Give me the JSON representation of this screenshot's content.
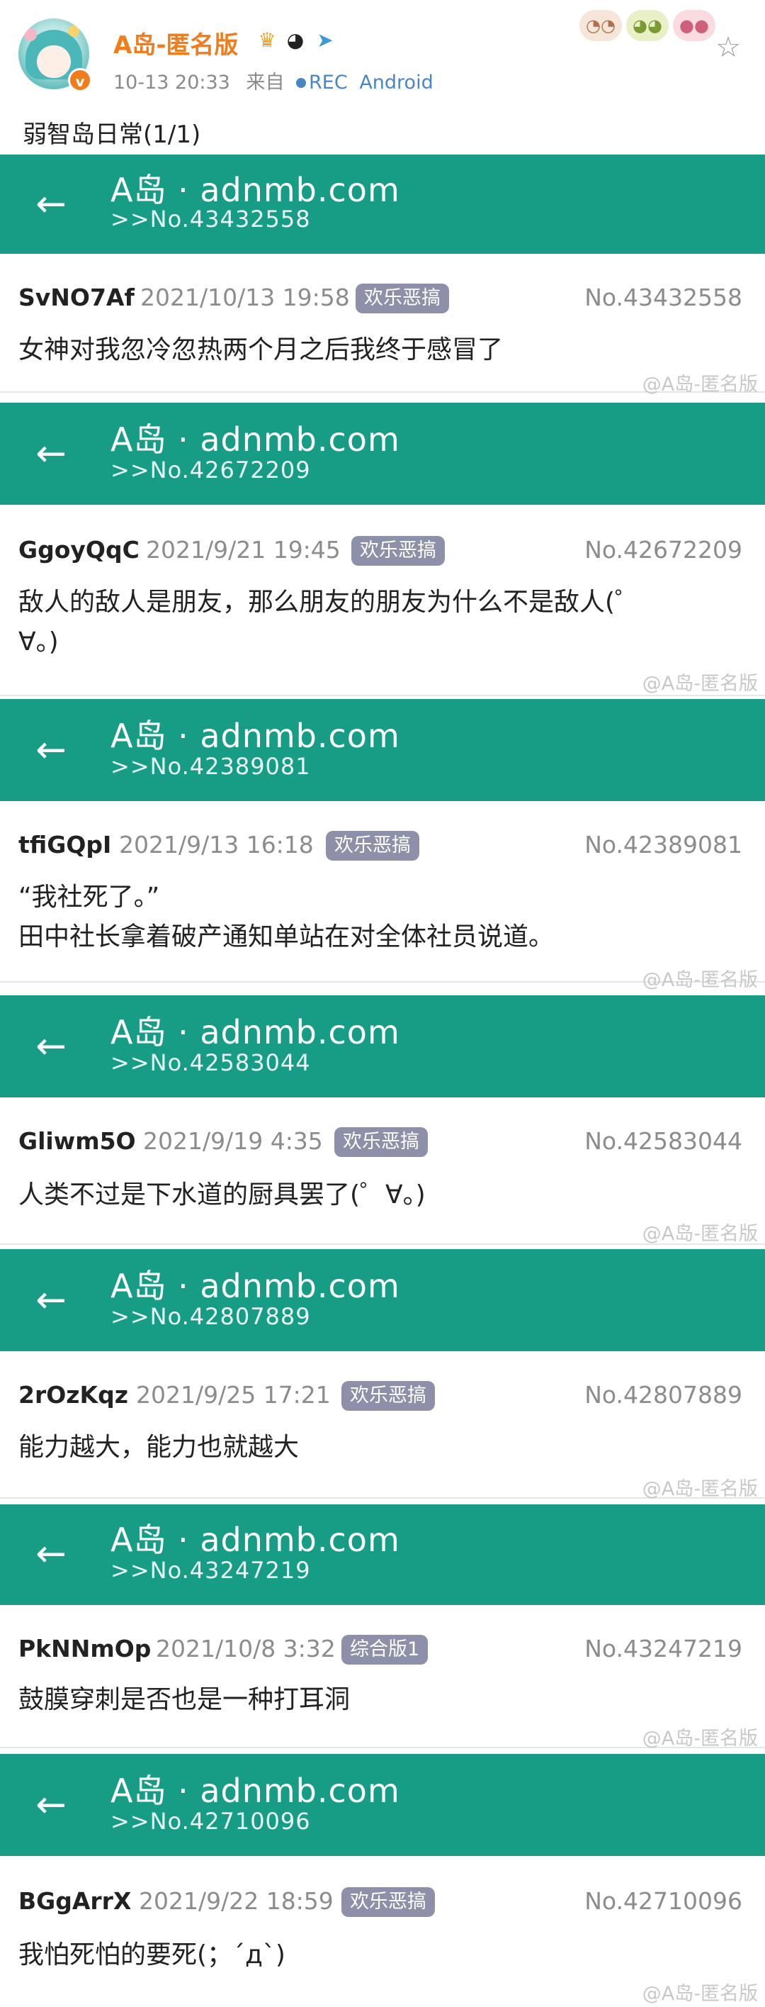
{
  "post": {
    "author": "A岛-匿名版",
    "time": "10-13 20:33",
    "from_label": "来自",
    "source": "REC",
    "client": "Android",
    "text": "弱智岛日常(1/1)",
    "author_icons": [
      "crown-icon",
      "panda-icon",
      "paper-plane-icon"
    ],
    "reaction_emojis": [
      "mouse-emoji",
      "frog-emoji",
      "pig-emoji"
    ]
  },
  "site_title": "A岛 · adnmb.com",
  "watermark_text": "@A岛-匿名版",
  "cards": [
    {
      "ref": ">>No.43432558",
      "uid": "SvNO7Af",
      "date": "2021/10/13 19:58",
      "tag": "欢乐恶搞",
      "no": "No.43432558",
      "content": "女神对我忽冷忽热两个月之后我终于感冒了"
    },
    {
      "ref": ">>No.42672209",
      "uid": "GgoyQqC",
      "date": "2021/9/21 19:45",
      "tag": "欢乐恶搞",
      "no": "No.42672209",
      "content": "敌人的敌人是朋友，那么朋友的朋友为什么不是敌人(゜\n∀。)"
    },
    {
      "ref": ">>No.42389081",
      "uid": "tfiGQpI",
      "date": "2021/9/13 16:18",
      "tag": "欢乐恶搞",
      "no": "No.42389081",
      "content": "“我社死了。”\n田中社长拿着破产通知单站在对全体社员说道。"
    },
    {
      "ref": ">>No.42583044",
      "uid": "Gliwm5O",
      "date": "2021/9/19 4:35",
      "tag": "欢乐恶搞",
      "no": "No.42583044",
      "content": "人类不过是下水道的厨具罢了(゜∀。)"
    },
    {
      "ref": ">>No.42807889",
      "uid": "2rOzKqz",
      "date": "2021/9/25 17:21",
      "tag": "欢乐恶搞",
      "no": "No.42807889",
      "content": "能力越大，能力也就越大"
    },
    {
      "ref": ">>No.43247219",
      "uid": "PkNNmOp",
      "date": "2021/10/8 3:32",
      "tag": "综合版1",
      "no": "No.43247219",
      "content": "鼓膜穿刺是否也是一种打耳洞"
    },
    {
      "ref": ">>No.42710096",
      "uid": "BGgArrX",
      "date": "2021/9/22 18:59",
      "tag": "欢乐恶搞",
      "no": "No.42710096",
      "content": "我怕死怕的要死(；´д`)"
    }
  ]
}
